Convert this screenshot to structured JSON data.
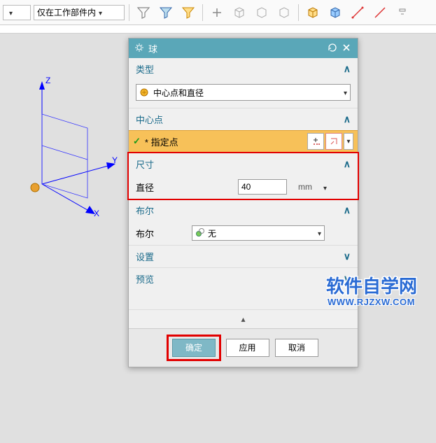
{
  "toolbar": {
    "filter_label": "仅在工作部件内"
  },
  "dialog": {
    "title": "球",
    "sections": {
      "type": {
        "header": "类型",
        "combo": "中心点和直径"
      },
      "center": {
        "header": "中心点",
        "point_label": "* 指定点"
      },
      "dimension": {
        "header": "尺寸",
        "diameter_label": "直径",
        "diameter_value": "40",
        "unit": "mm"
      },
      "boolean": {
        "header": "布尔",
        "label": "布尔",
        "value": "无"
      },
      "settings": {
        "header": "设置"
      },
      "preview": {
        "header": "预览"
      }
    },
    "buttons": {
      "ok": "确定",
      "apply": "应用",
      "cancel": "取消"
    }
  },
  "axes": {
    "x": "X",
    "y": "Y",
    "z": "Z"
  },
  "watermark": {
    "line1": "软件自学网",
    "line2": "WWW.RJZXW.COM"
  }
}
